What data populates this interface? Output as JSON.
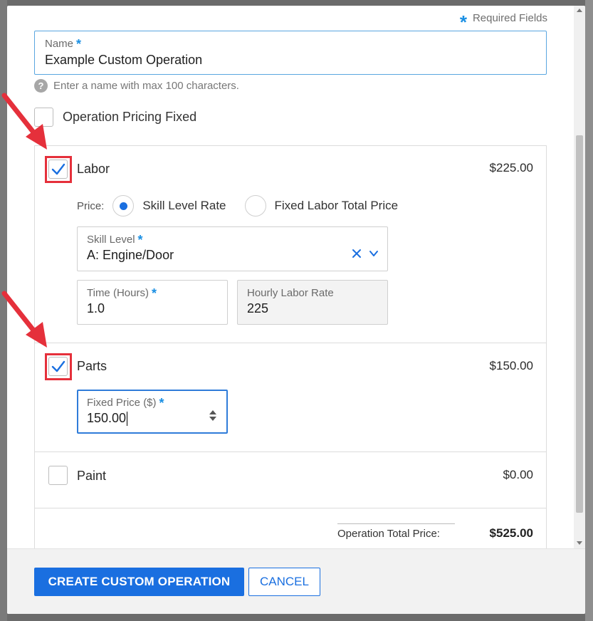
{
  "required_note": "Required Fields",
  "name_field": {
    "label": "Name",
    "value": "Example Custom Operation",
    "hint": "Enter a name with max 100 characters."
  },
  "pricing_fixed": {
    "label": "Operation Pricing Fixed",
    "checked": false
  },
  "labor": {
    "label": "Labor",
    "checked": true,
    "price": "$225.00",
    "price_label": "Price:",
    "options": [
      "Skill Level Rate",
      "Fixed Labor Total Price"
    ],
    "selected_option": "Skill Level Rate",
    "skill_level": {
      "label": "Skill Level",
      "value": "A: Engine/Door"
    },
    "time": {
      "label": "Time (Hours)",
      "value": "1.0"
    },
    "hourly_rate": {
      "label": "Hourly Labor Rate",
      "value": "225"
    }
  },
  "parts": {
    "label": "Parts",
    "checked": true,
    "price": "$150.00",
    "fixed_price": {
      "label": "Fixed Price ($)",
      "value": "150.00"
    }
  },
  "paint": {
    "label": "Paint",
    "checked": false,
    "price": "$0.00"
  },
  "total": {
    "label": "Operation Total Price:",
    "value": "$525.00"
  },
  "footer": {
    "create_label": "CREATE CUSTOM OPERATION",
    "cancel_label": "CANCEL"
  },
  "colors": {
    "accent": "#1a6fe0",
    "required_star": "#1a8fe3",
    "highlight": "#e5303b"
  },
  "icons": [
    "help-icon",
    "check-icon",
    "clear-icon",
    "chevron-down-icon",
    "spinner-icon",
    "arrow-icon"
  ]
}
